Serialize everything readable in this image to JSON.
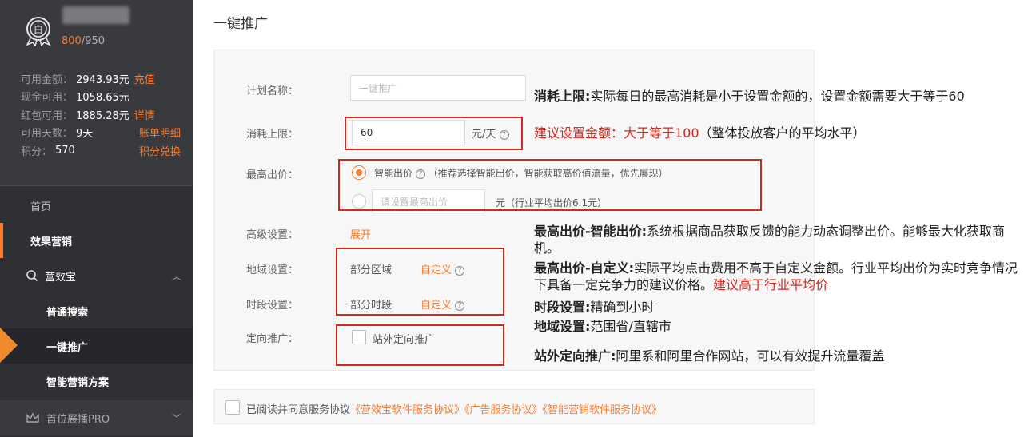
{
  "sidebar": {
    "score_current": "800",
    "score_total": "/950",
    "account": [
      {
        "label": "可用金额：",
        "value": "2943.93元",
        "link": "充值"
      },
      {
        "label": "现金可用：",
        "value": "1058.65元",
        "link": ""
      },
      {
        "label": "红包可用：",
        "value": "1885.28元",
        "link": "详情"
      },
      {
        "label": "可用天数：",
        "value": "9天",
        "link": "账单明细"
      },
      {
        "label": "积分：",
        "value": "570",
        "link": "积分兑换"
      }
    ],
    "nav": {
      "home": "首页",
      "effect_marketing": "效果营销",
      "yingxiaobao": "营效宝",
      "normal_search": "普通搜索",
      "one_click": "一键推广",
      "smart_plan": "智能营销方案",
      "top_pro": "首位展播PRO"
    }
  },
  "main": {
    "title": "一键推广",
    "plan_name_label": "计划名称：",
    "plan_name_placeholder": "一键推广",
    "budget_label": "消耗上限：",
    "budget_value": "60",
    "budget_unit": "元/天",
    "bid_label": "最高出价：",
    "bid_smart": "智能出价",
    "bid_smart_note": "（推荐选择智能出价，智能获取高价值流量，优先展现）",
    "bid_custom_placeholder": "请设置最高出价",
    "bid_custom_unit": "元（行业平均出价6.1元）",
    "advanced_label": "高级设置：",
    "advanced_link": "展开",
    "region_label": "地域设置：",
    "region_value": "部分区域",
    "region_link": "自定义",
    "time_label": "时段设置：",
    "time_value": "部分时段",
    "time_link": "自定义",
    "targeting_label": "定向推广：",
    "targeting_option": "站外定向推广",
    "agreement_text": "已阅读并同意服务协议",
    "agreement_links": "《营效宝软件服务协议》《广告服务协议》《智能营销软件服务协议》"
  },
  "annotations": {
    "budget_title": "消耗上限:",
    "budget_text": "实际每日的最高消耗是小于设置金额的，设置金额需要大于等于60",
    "budget_suggest": "建议设置金额：大于等于100",
    "budget_suggest_note": "（整体投放客户的平均水平）",
    "smart_title": "最高出价-智能出价:",
    "smart_text": "系统根据商品获取反馈的能力动态调整出价。能够最大化获取商机。",
    "custom_title": "最高出价-自定义:",
    "custom_text": "实际平均点击费用不高于自定义金额。行业平均出价为实时竞争情况下具备一定竞争力的建议价格。",
    "custom_suggest": "建议高于行业平均价",
    "time_title": "时段设置:",
    "time_text": "精确到小时",
    "region_title": "地域设置:",
    "region_text": "范围省/直辖市",
    "offsite_title": "站外定向推广:",
    "offsite_text": "阿里系和阿里合作网站，可以有效提升流量覆盖"
  }
}
